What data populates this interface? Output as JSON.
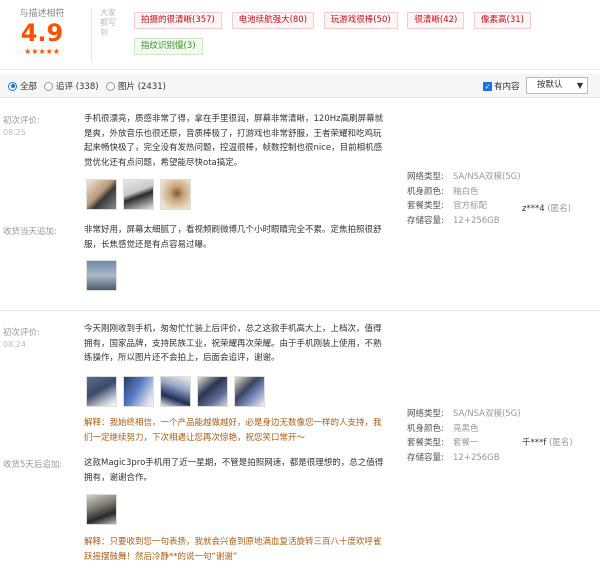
{
  "summary": {
    "title": "与描述相符",
    "score": "4.9",
    "stars": "★★★★★",
    "tag_heading": "大家都写到",
    "tags": [
      {
        "label": "拍摄的很清晰(357)",
        "color": "red"
      },
      {
        "label": "电池续航强大(80)",
        "color": "red"
      },
      {
        "label": "玩游戏很棒(50)",
        "color": "red"
      },
      {
        "label": "很清晰(42)",
        "color": "red"
      },
      {
        "label": "像素高(31)",
        "color": "red"
      },
      {
        "label": "指纹识别慢(3)",
        "color": "green"
      }
    ]
  },
  "filter": {
    "options": [
      "全部",
      "追评 (338)",
      "图片 (2431)"
    ],
    "selected": "全部",
    "has_content_label": "有内容",
    "has_content_checked": true,
    "sort_label": "按默认"
  },
  "reviews": [
    {
      "first_label": "初次评价:",
      "first_date": "08.25",
      "text": "手机很漂亮，质感非常了得，拿在手里很润，屏幕非常清晰，120Hz高刷屏幕就是爽，外放音乐也很还原，音质棒极了，打游戏也非常舒服，王者荣耀和吃鸡玩起来畅快极了，完全没有发热问题，控温很棒，帧数控制也很nice，目前相机感觉优化还有点问题，希望能尽快ota搞定。",
      "followup_label": "收货当天追加:",
      "followup_text": "非常好用，屏幕太细腻了，看视频刷微博几个小时眼睛完全不累。定焦拍照很舒服，长焦感觉还是有点容易过曝。",
      "specs": [
        {
          "k": "网络类型:",
          "v": "SA/NSA双模(5G)"
        },
        {
          "k": "机身颜色:",
          "v": "釉白色"
        },
        {
          "k": "套餐类型:",
          "v": "官方标配"
        },
        {
          "k": "存储容量:",
          "v": "12+256GB"
        }
      ],
      "user": "z***4",
      "anon": "(匿名)"
    },
    {
      "first_label": "初次评价:",
      "first_date": "08.24",
      "text": "今天刚刚收到手机，匆匆忙忙装上后评价，总之这款手机高大上，上档次，值得拥有，国家品牌，支持民族工业，祝荣耀再次荣耀。由于手机刚装上使用，不熟练操作，所以图片还不会拍上，后面会追评，谢谢。",
      "reply": "解释：我始终相信，一个产品能越做越好，必是身边无数像您一样的人支持，我们一定继续努力，下次相遇让您再次惊艳，祝您笑口常开～",
      "followup_label": "收货5天后追加:",
      "followup_text": "这款Magic3pro手机用了近一星期，不管是拍照网速，都是很理想的，总之值得拥有，谢谢合作。",
      "followup_reply": "解释：只要收到您一句表扬，我就会兴奋到原地满血复活旋转三百八十度欢呼雀跃摇摆鼓舞！然后冷静**的说一句“谢谢”",
      "specs": [
        {
          "k": "网络类型:",
          "v": "SA/NSA双模(5G)"
        },
        {
          "k": "机身颜色:",
          "v": "亮黑色"
        },
        {
          "k": "套餐类型:",
          "v": "套餐一"
        },
        {
          "k": "存储容量:",
          "v": "12+256GB"
        }
      ],
      "user": "千***f",
      "anon": "(匿名)"
    }
  ]
}
